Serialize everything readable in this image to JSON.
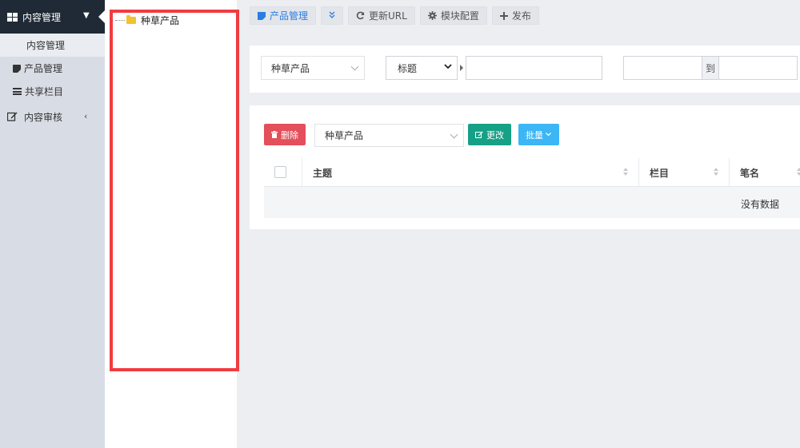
{
  "sidebar": {
    "header_label": "内容管理",
    "items": [
      {
        "label": "内容管理",
        "icon": "grid-icon"
      },
      {
        "label": "产品管理",
        "icon": "note-icon"
      },
      {
        "label": "共享栏目",
        "icon": "bars-icon"
      }
    ],
    "group_label": "内容审核",
    "group_icon": "edit-icon"
  },
  "tree": {
    "root_label": "种草产品",
    "highlight_color": "#f03c40"
  },
  "toolbar": {
    "product_manage": "产品管理",
    "update_url": "更新URL",
    "module_config": "模块配置",
    "publish": "发布"
  },
  "filter": {
    "category_value": "种草产品",
    "field_value": "标题",
    "range_separator": "到"
  },
  "actions": {
    "delete_label": "删除",
    "move_category_value": "种草产品",
    "change_label": "更改",
    "batch_label": "批量"
  },
  "table": {
    "columns": [
      "主题",
      "栏目",
      "笔名"
    ],
    "empty_text": "没有数据"
  },
  "colors": {
    "accent": "#2a7de1",
    "danger": "#e34f5a",
    "success": "#16a085",
    "info": "#3db6f5",
    "sidebar_header": "#1f2a36"
  }
}
